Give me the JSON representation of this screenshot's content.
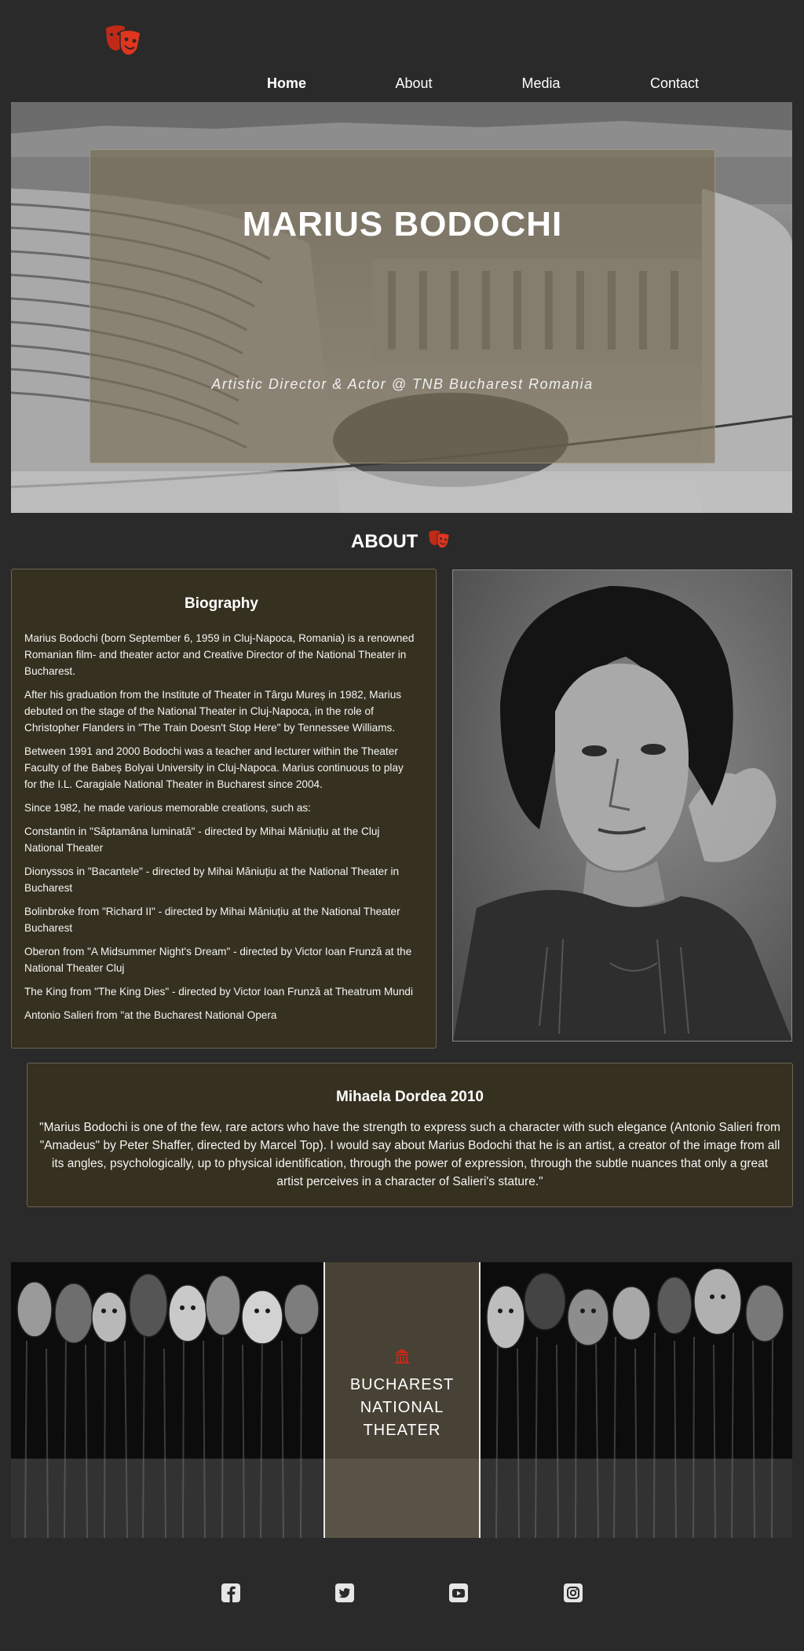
{
  "header": {
    "logo_icon": "theater-masks-icon",
    "nav": [
      {
        "label": "Home",
        "active": true
      },
      {
        "label": "About",
        "active": false
      },
      {
        "label": "Media",
        "active": false
      },
      {
        "label": "Contact",
        "active": false
      }
    ]
  },
  "hero": {
    "title": "MARIUS BODOCHI",
    "subtitle": "Artistic Director & Actor @ TNB Bucharest Romania"
  },
  "about": {
    "heading": "ABOUT",
    "icon": "theater-masks-icon"
  },
  "biography": {
    "title": "Biography",
    "paragraphs": [
      "Marius Bodochi (born September 6, 1959 in Cluj-Napoca, Romania) is a renowned Romanian film- and theater actor and Creative Director of the National Theater in Bucharest.",
      "After his graduation from the Institute of Theater in Târgu Mureș in 1982, Marius debuted on the stage of the National Theater in Cluj-Napoca, in the role of Christopher Flanders in \"The Train Doesn't Stop Here\" by Tennessee Williams.",
      "Between 1991 and 2000 Bodochi was a teacher and lecturer within the Theater Faculty of the Babeș Bolyai University in Cluj-Napoca. Marius continuous to play for the I.L. Caragiale National Theater in Bucharest since 2004.",
      "Since 1982, he made various memorable creations, such as:",
      "Constantin in \"Săptamâna luminată\" - directed by Mihai Măniuțiu at the Cluj National Theater",
      "Dionyssos in \"Bacantele\" - directed by Mihai Măniuțiu at the National Theater in Bucharest",
      "Bolinbroke from \"Richard II\" - directed by Mihai Măniuțiu at the National Theater Bucharest",
      "Oberon from \"A Midsummer Night's Dream\" - directed by Victor Ioan Frunză at the National Theater Cluj",
      "The King from \"The King Dies\" - directed by Victor Ioan Frunză at Theatrum Mundi",
      "Antonio Salieri from \"at the Bucharest National Opera"
    ]
  },
  "quote": {
    "author": "Mihaela Dordea 2010",
    "text": "\"Marius Bodochi is one of the few, rare actors who have the strength to express such a character with such elegance (Antonio Salieri from \"Amadeus\" by Peter Shaffer, directed by Marcel Top). I would say about Marius Bodochi that he is an artist, a creator of the image from all its angles, psychologically, up to physical identification, through the power of expression, through the subtle nuances that only a great artist perceives in a character of Salieri's stature.\""
  },
  "banner": {
    "line1": "BUCHAREST",
    "line2": "NATIONAL THEATER",
    "icon": "theater-building-icon"
  },
  "social": [
    {
      "icon": "facebook-icon"
    },
    {
      "icon": "twitter-icon"
    },
    {
      "icon": "youtube-icon"
    },
    {
      "icon": "instagram-icon"
    }
  ],
  "colors": {
    "background": "#2a2a2a",
    "card": "#35301f",
    "accent": "#d0301c"
  }
}
